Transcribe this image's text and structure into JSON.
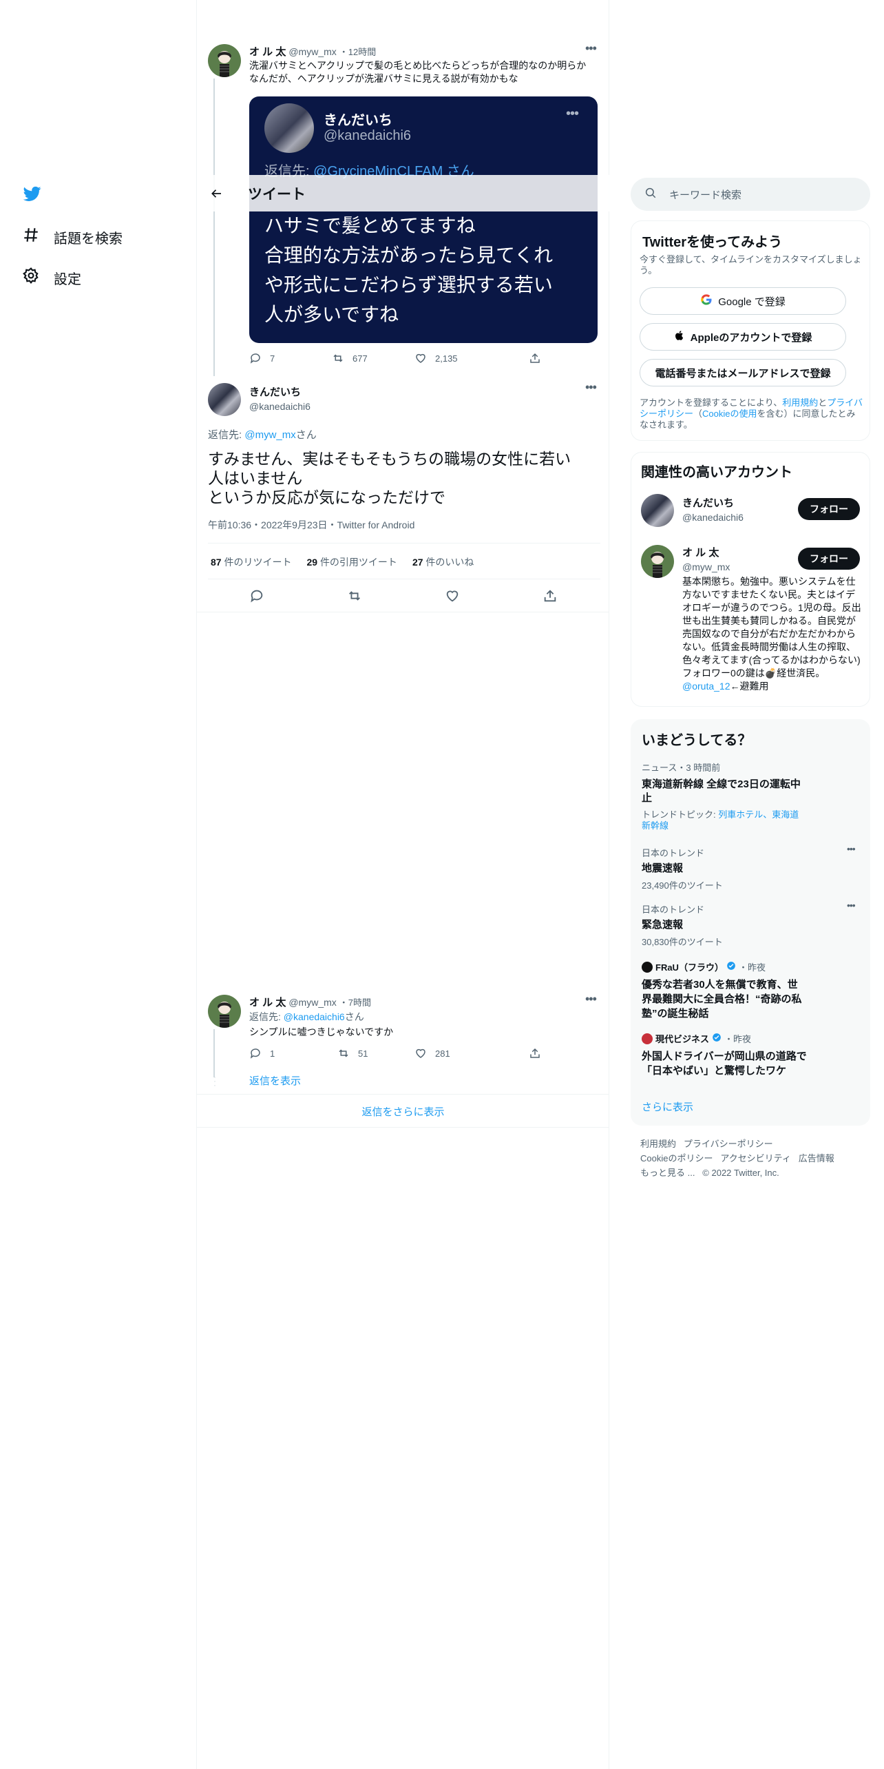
{
  "nav": {
    "items": [
      {
        "label": "話題を検索",
        "icon": "hashtag-icon"
      },
      {
        "label": "設定",
        "icon": "gear-icon"
      }
    ]
  },
  "header": {
    "title": "ツイート"
  },
  "parent_tweet": {
    "name": "オ ル 太",
    "handle": "@myw_mx",
    "time": "・12時間",
    "text": "洗濯バサミとヘアクリップで髪の毛とめ比べたらどっちが合理的なのか明らかなんだが、ヘアクリップが洗濯バサミに見える説が有効かもな",
    "quote": {
      "name": "きんだいち",
      "handle": "@kanedaichi6",
      "reply_prefix": "返信先: ",
      "reply_to": "@GrycineMinCLFAM さん",
      "lines": [
        "ハサミで髪とめてますね",
        "合理的な方法があったら見てくれ",
        "や形式にこだわらず選択する若い",
        "人が多いですね"
      ]
    },
    "stats": {
      "replies": "7",
      "retweets": "677",
      "likes": "2,135"
    }
  },
  "main_tweet": {
    "name": "きんだいち",
    "handle": "@kanedaichi6",
    "reply_prefix": "返信先: ",
    "reply_to": "@myw_mx",
    "reply_suffix": "さん",
    "text_lines": [
      "すみません、実はそもそもうちの職場の女性に若い",
      "人はいません",
      "というか反応が気になっただけで"
    ],
    "timestamp": "午前10:36・2022年9月23日・Twitter for Android",
    "retweets": "87",
    "retweets_label": "件のリツイート",
    "quotes": "29",
    "quotes_label": "件の引用ツイート",
    "likes": "27",
    "likes_label": "件のいいね"
  },
  "reply_tweet": {
    "name": "オ ル 太",
    "handle": "@myw_mx",
    "time": "・7時間",
    "reply_prefix": "返信先: ",
    "reply_to": "@kanedaichi6",
    "reply_suffix": "さん",
    "text": "シンプルに嘘つきじゃないですか",
    "stats": {
      "replies": "1",
      "retweets": "51",
      "likes": "281"
    },
    "show_replies": "返信を表示"
  },
  "show_more_replies": "返信をさらに表示",
  "search": {
    "placeholder": "キーワード検索"
  },
  "signup": {
    "title": "Twitterを使ってみよう",
    "subtitle": "今すぐ登録して、タイムラインをカスタマイズしましょう。",
    "google": "Google で登録",
    "apple": "Appleのアカウントで登録",
    "phone": "電話番号またはメールアドレスで登録",
    "legal_1": "アカウントを登録することにより、",
    "terms": "利用規約",
    "and": "と",
    "privacy": "プライバシーポリシー",
    "cookie_open": "（",
    "cookie": "Cookieの使用",
    "legal_2": "を含む）に同意したとみなされます。"
  },
  "related": {
    "title": "関連性の高いアカウント",
    "follow": "フォロー",
    "accounts": [
      {
        "name": "きんだいち",
        "handle": "@kanedaichi6"
      },
      {
        "name": "オ ル 太",
        "handle": "@myw_mx",
        "bio": "基本閑懲ち。勉強中。悪いシステムを仕方ないですませたくない民。夫とはイデオロギーが違うのでつら。1児の母。反出世も出生賛美も賛同しかねる。自民党が売国奴なので自分が右だか左だかわからない。低賃金長時間労働は人生の搾取、色々考えてます(合ってるかはわからない)フォロワー0の鍵は💣経世済民。",
        "bio_link": "@oruta_12",
        "bio_tail": "←避難用"
      }
    ]
  },
  "trends": {
    "title": "いまどうしてる？",
    "items": [
      {
        "meta": "ニュース・3 時間前",
        "title": "東海道新幹線 全線で23日の運転中止",
        "topic_label": "トレンドトピック: ",
        "topic": "列車ホテル、東海道新幹線"
      },
      {
        "meta": "日本のトレンド",
        "title": "地震速報",
        "count": "23,490件のツイート"
      },
      {
        "meta": "日本のトレンド",
        "title": "緊急速報",
        "count": "30,830件のツイート"
      },
      {
        "source": "FRaU（フラウ）",
        "time": "・昨夜",
        "title": "優秀な若者30人を無償で教育、世界最難関大に全員合格！“奇跡の私塾”の誕生秘話"
      },
      {
        "source": "現代ビジネス",
        "time": "・昨夜",
        "title": "外国人ドライバーが岡山県の道路で「日本やばい」と驚愕したワケ"
      }
    ],
    "show_more": "さらに表示"
  },
  "footer": {
    "links": [
      "利用規約",
      "プライバシーポリシー",
      "Cookieのポリシー",
      "アクセシビリティ",
      "広告情報",
      "もっと見る ..."
    ],
    "copyright": "© 2022 Twitter, Inc."
  },
  "colors": {
    "accent": "#1d9bf0",
    "quote_bg": "#0a1745",
    "text": "#0f1419",
    "secondary": "#536471"
  }
}
